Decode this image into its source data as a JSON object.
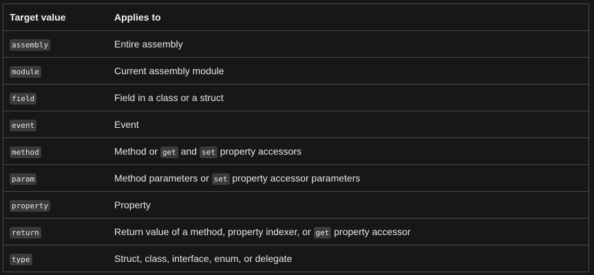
{
  "header": {
    "col1": "Target value",
    "col2": "Applies to"
  },
  "rows": [
    {
      "target": "assembly",
      "parts": [
        "Entire assembly"
      ]
    },
    {
      "target": "module",
      "parts": [
        "Current assembly module"
      ]
    },
    {
      "target": "field",
      "parts": [
        "Field in a class or a struct"
      ]
    },
    {
      "target": "event",
      "parts": [
        "Event"
      ]
    },
    {
      "target": "method",
      "parts": [
        "Method or ",
        "get",
        " and ",
        "set",
        " property accessors"
      ]
    },
    {
      "target": "param",
      "parts": [
        "Method parameters or ",
        "set",
        " property accessor parameters"
      ]
    },
    {
      "target": "property",
      "parts": [
        "Property"
      ]
    },
    {
      "target": "return",
      "parts": [
        "Return value of a method, property indexer, or ",
        "get",
        " property accessor"
      ]
    },
    {
      "target": "type",
      "parts": [
        "Struct, class, interface, enum, or delegate"
      ]
    }
  ]
}
